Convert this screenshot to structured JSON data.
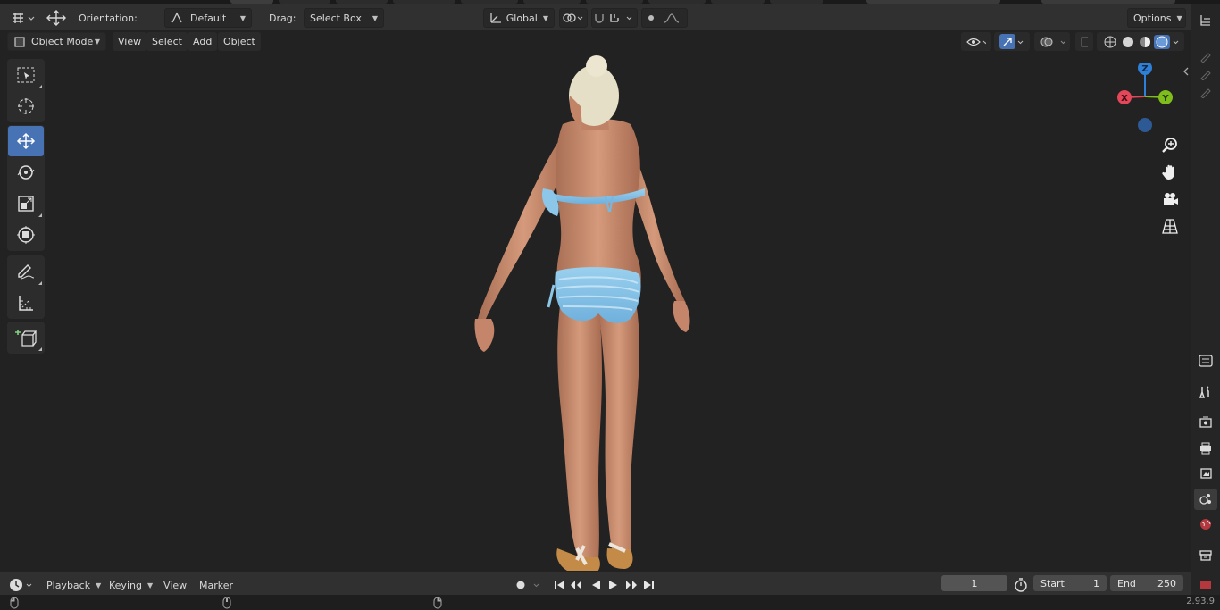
{
  "header": {
    "orientation_label": "Orientation:",
    "orientation_value": "Default",
    "drag_label": "Drag:",
    "drag_value": "Select Box",
    "transform_space": "Global",
    "options_label": "Options"
  },
  "viewport_menu": {
    "mode": "Object Mode",
    "items": [
      "View",
      "Select",
      "Add",
      "Object"
    ]
  },
  "gizmo": {
    "x": "X",
    "y": "Y",
    "z": "Z"
  },
  "tools": [
    {
      "name": "select-box-tool",
      "icon": "select-box-icon",
      "active": false
    },
    {
      "name": "cursor-tool",
      "icon": "cursor-icon",
      "active": false
    },
    {
      "name": "move-tool",
      "icon": "move-icon",
      "active": true
    },
    {
      "name": "rotate-tool",
      "icon": "rotate-icon",
      "active": false
    },
    {
      "name": "scale-tool",
      "icon": "scale-icon",
      "active": false
    },
    {
      "name": "transform-tool",
      "icon": "transform-icon",
      "active": false
    },
    {
      "name": "annotate-tool",
      "icon": "annotate-icon",
      "active": false
    },
    {
      "name": "measure-tool",
      "icon": "measure-icon",
      "active": false
    },
    {
      "name": "add-cube-tool",
      "icon": "add-cube-icon",
      "active": false
    }
  ],
  "timeline": {
    "menus": [
      "Playback",
      "Keying",
      "View",
      "Marker"
    ],
    "current_frame": "1",
    "start_label": "Start",
    "start_value": "1",
    "end_label": "End",
    "end_value": "250"
  },
  "status": {
    "version": "2.93.9"
  },
  "colors": {
    "accent": "#4772b3",
    "axis_x": "#e5475a",
    "axis_y": "#7fbd1c",
    "axis_z": "#2f7fd6",
    "bikini": "#8cc6e8",
    "skin": "#c98a6a",
    "hair": "#e8e2cc"
  }
}
